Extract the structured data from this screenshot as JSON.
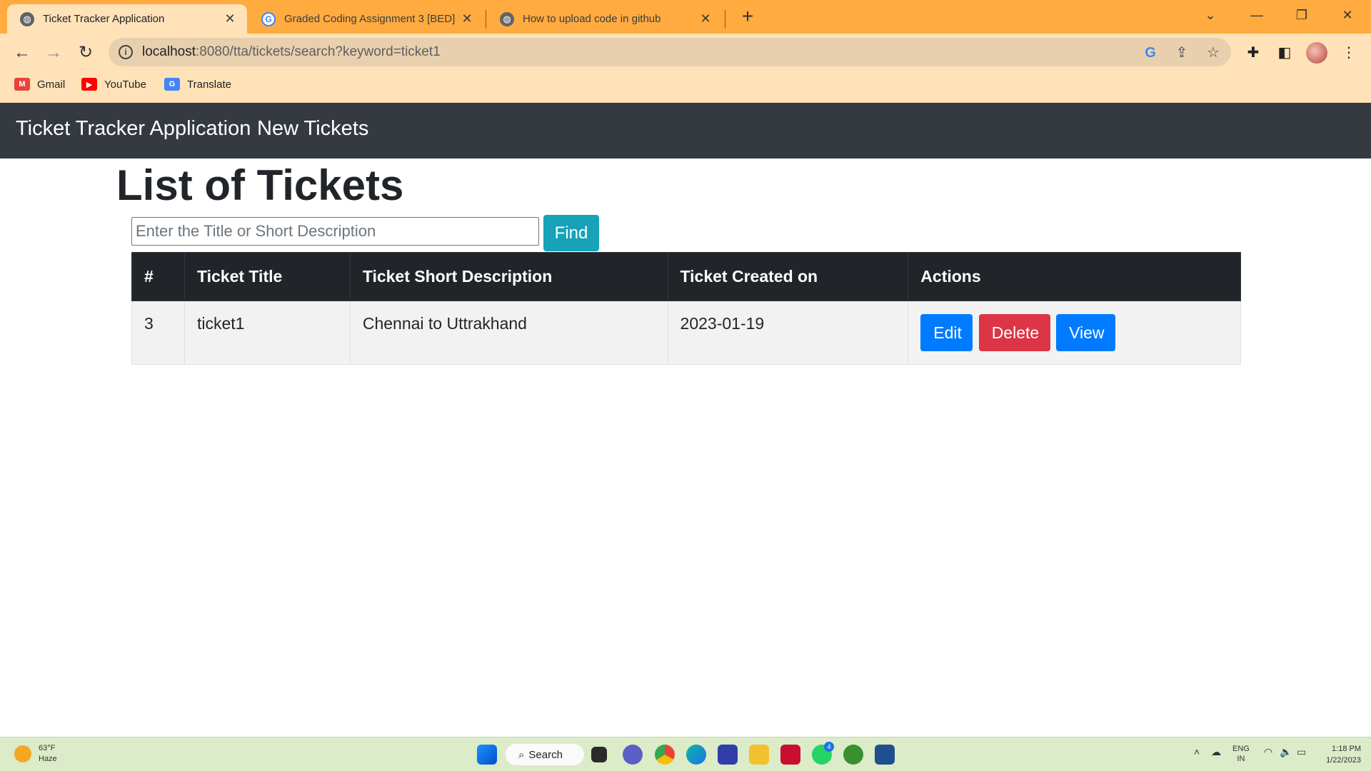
{
  "browser": {
    "tabs": [
      {
        "title": "Ticket Tracker Application",
        "active": true,
        "favicon": "globe-icon"
      },
      {
        "title": "Graded Coding Assignment 3 [BED]",
        "active": false,
        "favicon": "google-icon"
      },
      {
        "title": "How to upload code in github",
        "active": false,
        "favicon": "globe-icon"
      }
    ],
    "url_host": "localhost",
    "url_path": ":8080/tta/tickets/search?keyword=ticket1",
    "bookmarks": [
      {
        "label": "Gmail",
        "icon": "gmail-icon"
      },
      {
        "label": "YouTube",
        "icon": "youtube-icon"
      },
      {
        "label": "Translate",
        "icon": "translate-icon"
      }
    ],
    "accent_color": "#ffab40"
  },
  "navbar": {
    "brand": "Ticket Tracker Application",
    "link_new": "New Tickets"
  },
  "page": {
    "title": "List of Tickets",
    "search": {
      "placeholder": "Enter the Title or Short Description",
      "value": "",
      "button": "Find"
    },
    "table": {
      "headers": [
        "#",
        "Ticket Title",
        "Ticket Short Description",
        "Ticket Created on",
        "Actions"
      ],
      "rows": [
        {
          "id": "3",
          "title": "ticket1",
          "description": "Chennai to Uttrakhand",
          "created": "2023-01-19"
        }
      ],
      "actions": {
        "edit": "Edit",
        "delete": "Delete",
        "view": "View"
      }
    }
  },
  "taskbar": {
    "weather_temp": "63°F",
    "weather_desc": "Haze",
    "search_label": "Search",
    "lang_top": "ENG",
    "lang_bottom": "IN",
    "time": "1:18 PM",
    "date": "1/22/2023",
    "whatsapp_badge": "4"
  }
}
